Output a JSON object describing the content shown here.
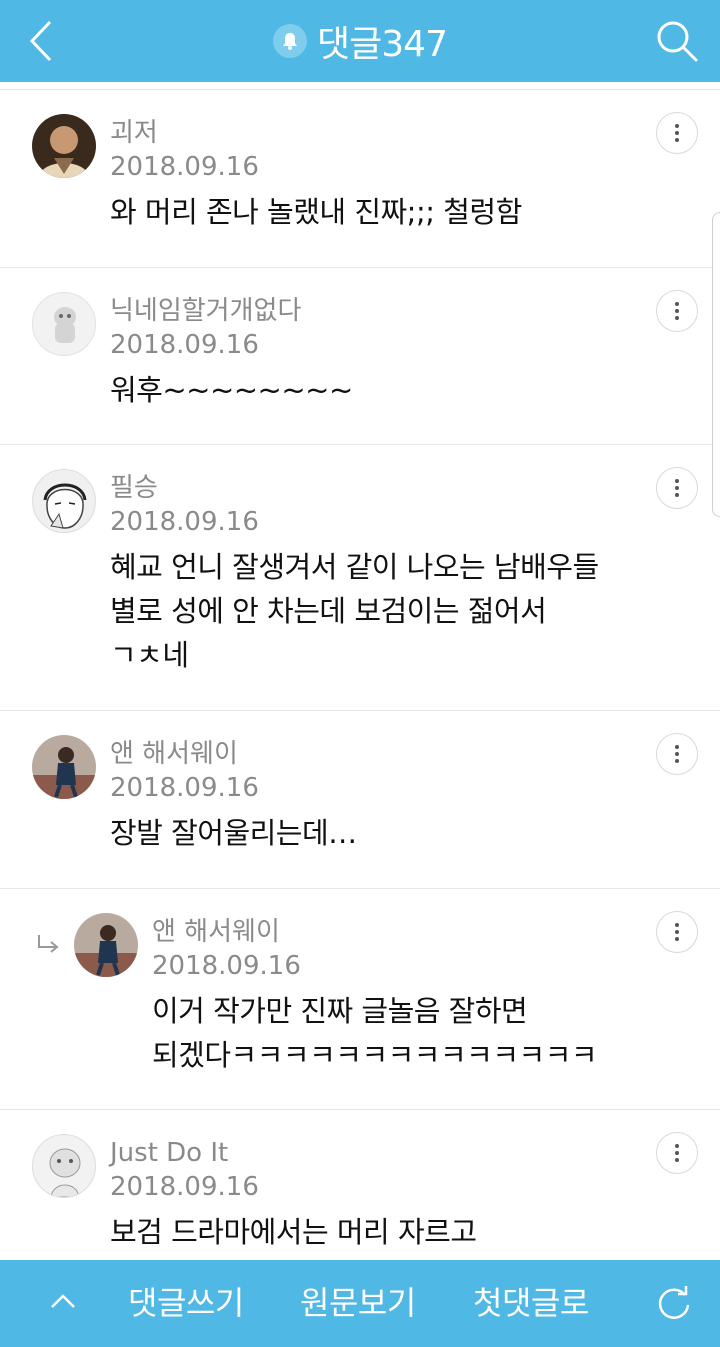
{
  "header": {
    "title": "댓글347",
    "back_icon": "chevron-left-icon",
    "bell_icon": "bell-icon",
    "search_icon": "search-icon",
    "color": "#4fb8e4"
  },
  "comments": [
    {
      "nickname": "괴저",
      "date": "2018.09.16",
      "lines": [
        "와 머리 존나 놀랬내 진짜;;; 철렁함"
      ],
      "is_reply": false
    },
    {
      "nickname": "닉네임할거개없다",
      "date": "2018.09.16",
      "lines": [
        "워후~~~~~~~~"
      ],
      "is_reply": false
    },
    {
      "nickname": "필승",
      "date": "2018.09.16",
      "lines": [
        "혜교 언니 잘생겨서 같이 나오는 남배우들",
        "별로 성에 안 차는데 보검이는 젊어서",
        "ㄱㅊ네"
      ],
      "is_reply": false
    },
    {
      "nickname": "앤 해서웨이",
      "date": "2018.09.16",
      "lines": [
        "장발 잘어울리는데…"
      ],
      "is_reply": false
    },
    {
      "nickname": "앤 해서웨이",
      "date": "2018.09.16",
      "lines": [
        "이거 작가만 진짜 글놀음 잘하면",
        "되겠다ㅋㅋㅋㅋㅋㅋㅋㅋㅋㅋㅋㅋㅋㅋ"
      ],
      "is_reply": true
    },
    {
      "nickname": "Just Do It",
      "date": "2018.09.16",
      "lines": [
        "보검 드라마에서는 머리 자르고"
      ],
      "is_reply": false
    }
  ],
  "bottom": {
    "write_label": "댓글쓰기",
    "original_label": "원문보기",
    "first_label": "첫댓글로",
    "up_icon": "chevron-up-icon",
    "refresh_icon": "refresh-icon"
  }
}
